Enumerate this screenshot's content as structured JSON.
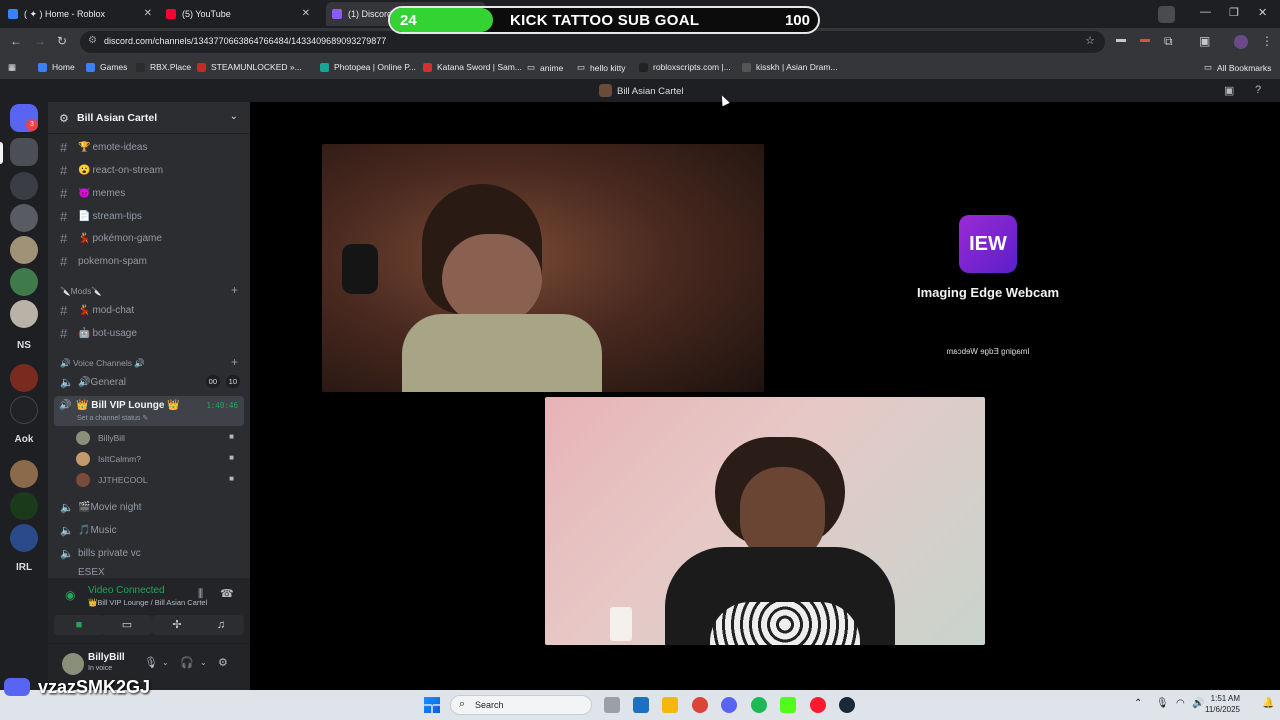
{
  "browser": {
    "tabs": [
      {
        "label": "( ✦ ) Home - Roblox",
        "active": false
      },
      {
        "label": "(5) YouTube",
        "active": false
      },
      {
        "label": "(1) Discord",
        "active": true
      }
    ],
    "new_tab_label": "+",
    "url": "discord.com/channels/1343770663864766484/1433409689093279877",
    "bookmarks": [
      "Home",
      "Games",
      "RBX.Place",
      "STEAMUNLOCKED »...",
      "Photopea | Online P...",
      "Katana Sword | Sam...",
      "anime",
      "hello kitty",
      "robloxscripts.com |...",
      "kisskh | Asian Dram...",
      "All Bookmarks"
    ]
  },
  "goal_overlay": {
    "current": "24",
    "title": "KICK TATTOO SUB GOAL",
    "target": "100",
    "progress_fraction": 0.24,
    "color": "#34d334"
  },
  "discord": {
    "window_title": "Bill Asian Cartel",
    "rail_badge": "3",
    "rail_labels": [
      "NS",
      "Aok",
      "IRL"
    ],
    "server_name": "Bill Asian Cartel",
    "channels": [
      {
        "emoji": "🏆",
        "label": "emote-ideas"
      },
      {
        "emoji": "😮",
        "label": "react-on-stream"
      },
      {
        "emoji": "😈",
        "label": "memes"
      },
      {
        "emoji": "📄",
        "label": "stream-tips"
      },
      {
        "emoji": "💃",
        "label": "pokémon-game"
      },
      {
        "emoji": "",
        "label": "pokemon-spam"
      }
    ],
    "mods_category": "🔪Mods🔪",
    "mod_channels": [
      {
        "emoji": "💃",
        "label": "mod-chat"
      },
      {
        "emoji": "🤖",
        "label": "bot-usage"
      }
    ],
    "voice_category": "🔊 Voice Channels 🔊",
    "voice_general": {
      "label": "🔊General",
      "chip_a": "00",
      "chip_b": "10"
    },
    "voice_vip": {
      "label": "👑 Bill VIP Lounge 👑",
      "status": "Set a channel status ✎",
      "timer": "1:40:46"
    },
    "members": [
      "BillyBill",
      "IsItCalmm?",
      "JJTHECOOL"
    ],
    "voice_others": [
      "🎬Movie night",
      "🎵Music",
      "bills private vc",
      "ESEX"
    ],
    "voice_panel": {
      "status": "Video Connected",
      "location": "👑Bill VIP Lounge / Bill Asian Cartel"
    },
    "user": {
      "name": "BillyBill",
      "status": "In voice"
    },
    "webcam_tile": {
      "logo_text": "IEW",
      "label": "Imaging Edge Webcam",
      "mirror_label": "Imaging Edge Webcam"
    }
  },
  "watermark": {
    "handle": "vzazSMK2GJ"
  },
  "taskbar": {
    "search_label": "Search",
    "time": "1:51 AM",
    "date": "11/6/2025"
  }
}
